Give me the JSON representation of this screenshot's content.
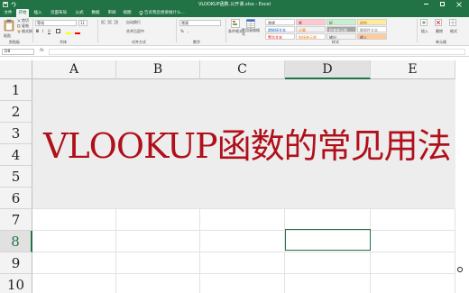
{
  "app": {
    "window_title": "VLOOKUP函数.公开课.xlsx - Excel"
  },
  "tabs": [
    "文件",
    "开始",
    "插入",
    "页面布局",
    "公式",
    "数据",
    "审阅",
    "视图"
  ],
  "tell_me": "告诉我您想要做什么...",
  "ribbon": {
    "clipboard": {
      "paste": "粘贴",
      "cut": "剪切",
      "copy": "复制",
      "format_painter": "格式刷",
      "group": "剪贴板"
    },
    "font": {
      "name": "等线",
      "size": "11",
      "group": "字体"
    },
    "alignment": {
      "wrap": "自动换行",
      "merge": "合并后居中",
      "group": "对齐方式"
    },
    "number": {
      "format": "常规",
      "group": "数字"
    },
    "styles": {
      "conditional": "条件格式",
      "table": "套用表格格式",
      "group": "样式",
      "cells": [
        {
          "label": "常规",
          "bg": "#ffffff",
          "fg": "#333333"
        },
        {
          "label": "差",
          "bg": "#ffc7ce",
          "fg": "#9c0006"
        },
        {
          "label": "好",
          "bg": "#c6efce",
          "fg": "#006100"
        },
        {
          "label": "适中",
          "bg": "#ffeb9c",
          "fg": "#9c5700"
        },
        {
          "label": "超链接文本",
          "bg": "#ffffff",
          "fg": "#0563c1"
        },
        {
          "label": "计算",
          "bg": "#f2f2f2",
          "fg": "#fa7d00"
        },
        {
          "label": "检查单元格",
          "bg": "#a5a5a5",
          "fg": "#ffffff"
        },
        {
          "label": "解释性文本",
          "bg": "#ffffff",
          "fg": "#7f7f7f"
        },
        {
          "label": "警告文本",
          "bg": "#ffffff",
          "fg": "#ff0000"
        },
        {
          "label": "链接单元格",
          "bg": "#ffffff",
          "fg": "#fa7d00"
        },
        {
          "label": "输出",
          "bg": "#f2f2f2",
          "fg": "#3f3f3f"
        },
        {
          "label": "输入",
          "bg": "#ffcc99",
          "fg": "#3f3f76"
        }
      ]
    },
    "cells": {
      "insert": "插入",
      "delete": "删除",
      "format": "格式",
      "group": "单元格"
    }
  },
  "formula_bar": {
    "name_box": "D8",
    "fx": "fx",
    "value": ""
  },
  "columns": [
    "A",
    "B",
    "C",
    "D",
    "E"
  ],
  "selected_column": "D",
  "rows": [
    "1",
    "2",
    "3",
    "4",
    "5",
    "6",
    "7",
    "8",
    "9",
    "10"
  ],
  "selected_row": "8",
  "banner_text": "VLOOKUP函数的常见用法",
  "colors": {
    "accent": "#217346",
    "banner_text": "#b0101a",
    "banner_bg": "#ededed"
  }
}
